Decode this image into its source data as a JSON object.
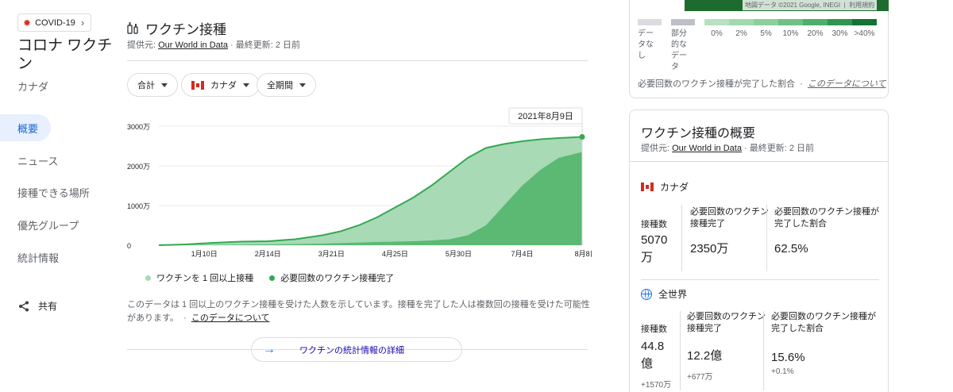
{
  "sidebar": {
    "chip_label": "COVID-19",
    "title": "コロナ ワクチン",
    "subtitle": "カナダ",
    "nav": [
      "概要",
      "ニュース",
      "接種できる場所",
      "優先グループ",
      "統計情報"
    ],
    "share_label": "共有"
  },
  "main": {
    "title": "ワクチン接種",
    "source_prefix": "提供元: ",
    "source_link": "Our World in Data",
    "source_suffix": " · 最終更新: 2 日前",
    "filters": {
      "total": "合計",
      "country": "カナダ",
      "period": "全期間"
    },
    "legend": [
      "ワクチンを 1 回以上接種",
      "必要回数のワクチン接種完了"
    ],
    "note": "このデータは 1 回以上のワクチン接種を受けた人数を示しています。接種を完了した人は複数回の接種を受けた可能性があります。",
    "note_link": "このデータについて",
    "note_sep": "·",
    "stats_button": "ワクチンの統計情報の詳細"
  },
  "chart_data": {
    "type": "area",
    "tooltip": "2021年8月9日",
    "y_ticks": [
      "0",
      "1000万",
      "2000万",
      "3000万"
    ],
    "ylim": [
      0,
      30000000
    ],
    "x_ticks": [
      "1月10日",
      "2月14日",
      "3月21日",
      "4月25日",
      "5月30日",
      "7月4日",
      "8月8日"
    ],
    "x_start_day": 0,
    "x_end_day": 233,
    "x_tick_days": [
      25,
      60,
      95,
      130,
      165,
      200,
      235
    ],
    "colors": {
      "at_least_one": "#a8dab5",
      "fully": "#5bb974",
      "line": "#34a853"
    },
    "series": [
      {
        "name": "ワクチンを 1 回以上接種",
        "points": [
          [
            0,
            0
          ],
          [
            15,
            200000
          ],
          [
            30,
            600000
          ],
          [
            45,
            900000
          ],
          [
            60,
            1000000
          ],
          [
            75,
            1500000
          ],
          [
            90,
            2500000
          ],
          [
            100,
            3500000
          ],
          [
            110,
            5000000
          ],
          [
            120,
            7000000
          ],
          [
            130,
            9500000
          ],
          [
            140,
            12000000
          ],
          [
            150,
            15000000
          ],
          [
            160,
            18500000
          ],
          [
            170,
            22000000
          ],
          [
            180,
            24500000
          ],
          [
            190,
            25500000
          ],
          [
            200,
            26200000
          ],
          [
            210,
            26700000
          ],
          [
            220,
            27000000
          ],
          [
            233,
            27300000
          ]
        ]
      },
      {
        "name": "必要回数のワクチン接種完了",
        "points": [
          [
            0,
            0
          ],
          [
            30,
            100000
          ],
          [
            60,
            200000
          ],
          [
            90,
            400000
          ],
          [
            120,
            800000
          ],
          [
            140,
            1000000
          ],
          [
            150,
            1200000
          ],
          [
            160,
            1500000
          ],
          [
            170,
            2500000
          ],
          [
            180,
            5000000
          ],
          [
            190,
            10000000
          ],
          [
            200,
            15000000
          ],
          [
            210,
            19000000
          ],
          [
            220,
            22000000
          ],
          [
            233,
            23500000
          ]
        ]
      }
    ]
  },
  "map_legend": {
    "attribution": "地図データ ©2021 Google, INEGI",
    "terms": "利用規約",
    "no_data": "データなし",
    "partial": "部分的なデータ",
    "bins": [
      "0%",
      "2%",
      "5%",
      "10%",
      "20%",
      "30%",
      ">40%"
    ],
    "bin_colors": [
      "#b7e1c1",
      "#a2d8ae",
      "#8ccf9c",
      "#6fc085",
      "#4fae6a",
      "#2f9650",
      "#137333"
    ],
    "no_data_color": "#dadce0",
    "partial_color": "#bdc1c6",
    "caption": "必要回数のワクチン接種が完了した割合",
    "caption_link": "このデータについて"
  },
  "overview": {
    "title": "ワクチン接種の概要",
    "source_prefix": "提供元: ",
    "source_link": "Our World in Data",
    "source_suffix": " · 最終更新: 2 日前",
    "canada": {
      "name": "カナダ",
      "labels": [
        "接種数",
        "必要回数のワクチン接種完了",
        "必要回数のワクチン接種が完了した割合"
      ],
      "values": [
        "5070万",
        "2350万",
        "62.5%"
      ]
    },
    "world": {
      "name": "全世界",
      "labels": [
        "接種数",
        "必要回数のワクチン接種完了",
        "必要回数のワクチン接種が完了した割合"
      ],
      "values": [
        "44.8億",
        "12.2億",
        "15.6%"
      ],
      "deltas": [
        "+1570万",
        "+677万",
        "+0.1%"
      ]
    }
  }
}
